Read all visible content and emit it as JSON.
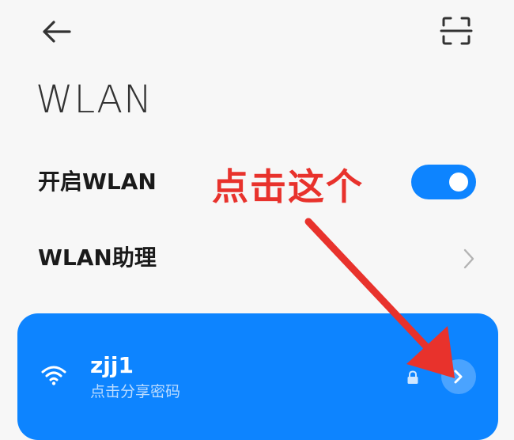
{
  "header": {
    "back_icon": "arrow-left-icon",
    "scan_icon": "scan-qr-icon"
  },
  "page": {
    "title": "WLAN"
  },
  "settings": {
    "wlan_toggle_label": "开启WLAN",
    "wlan_enabled": true,
    "assistant_label": "WLAN助理"
  },
  "annotation": {
    "text": "点击这个",
    "color": "#e8322c"
  },
  "connected_network": {
    "name": "zjj1",
    "subtitle": "点击分享密码",
    "secured": true
  },
  "colors": {
    "accent": "#0d84ff",
    "background": "#f7f7f7"
  }
}
